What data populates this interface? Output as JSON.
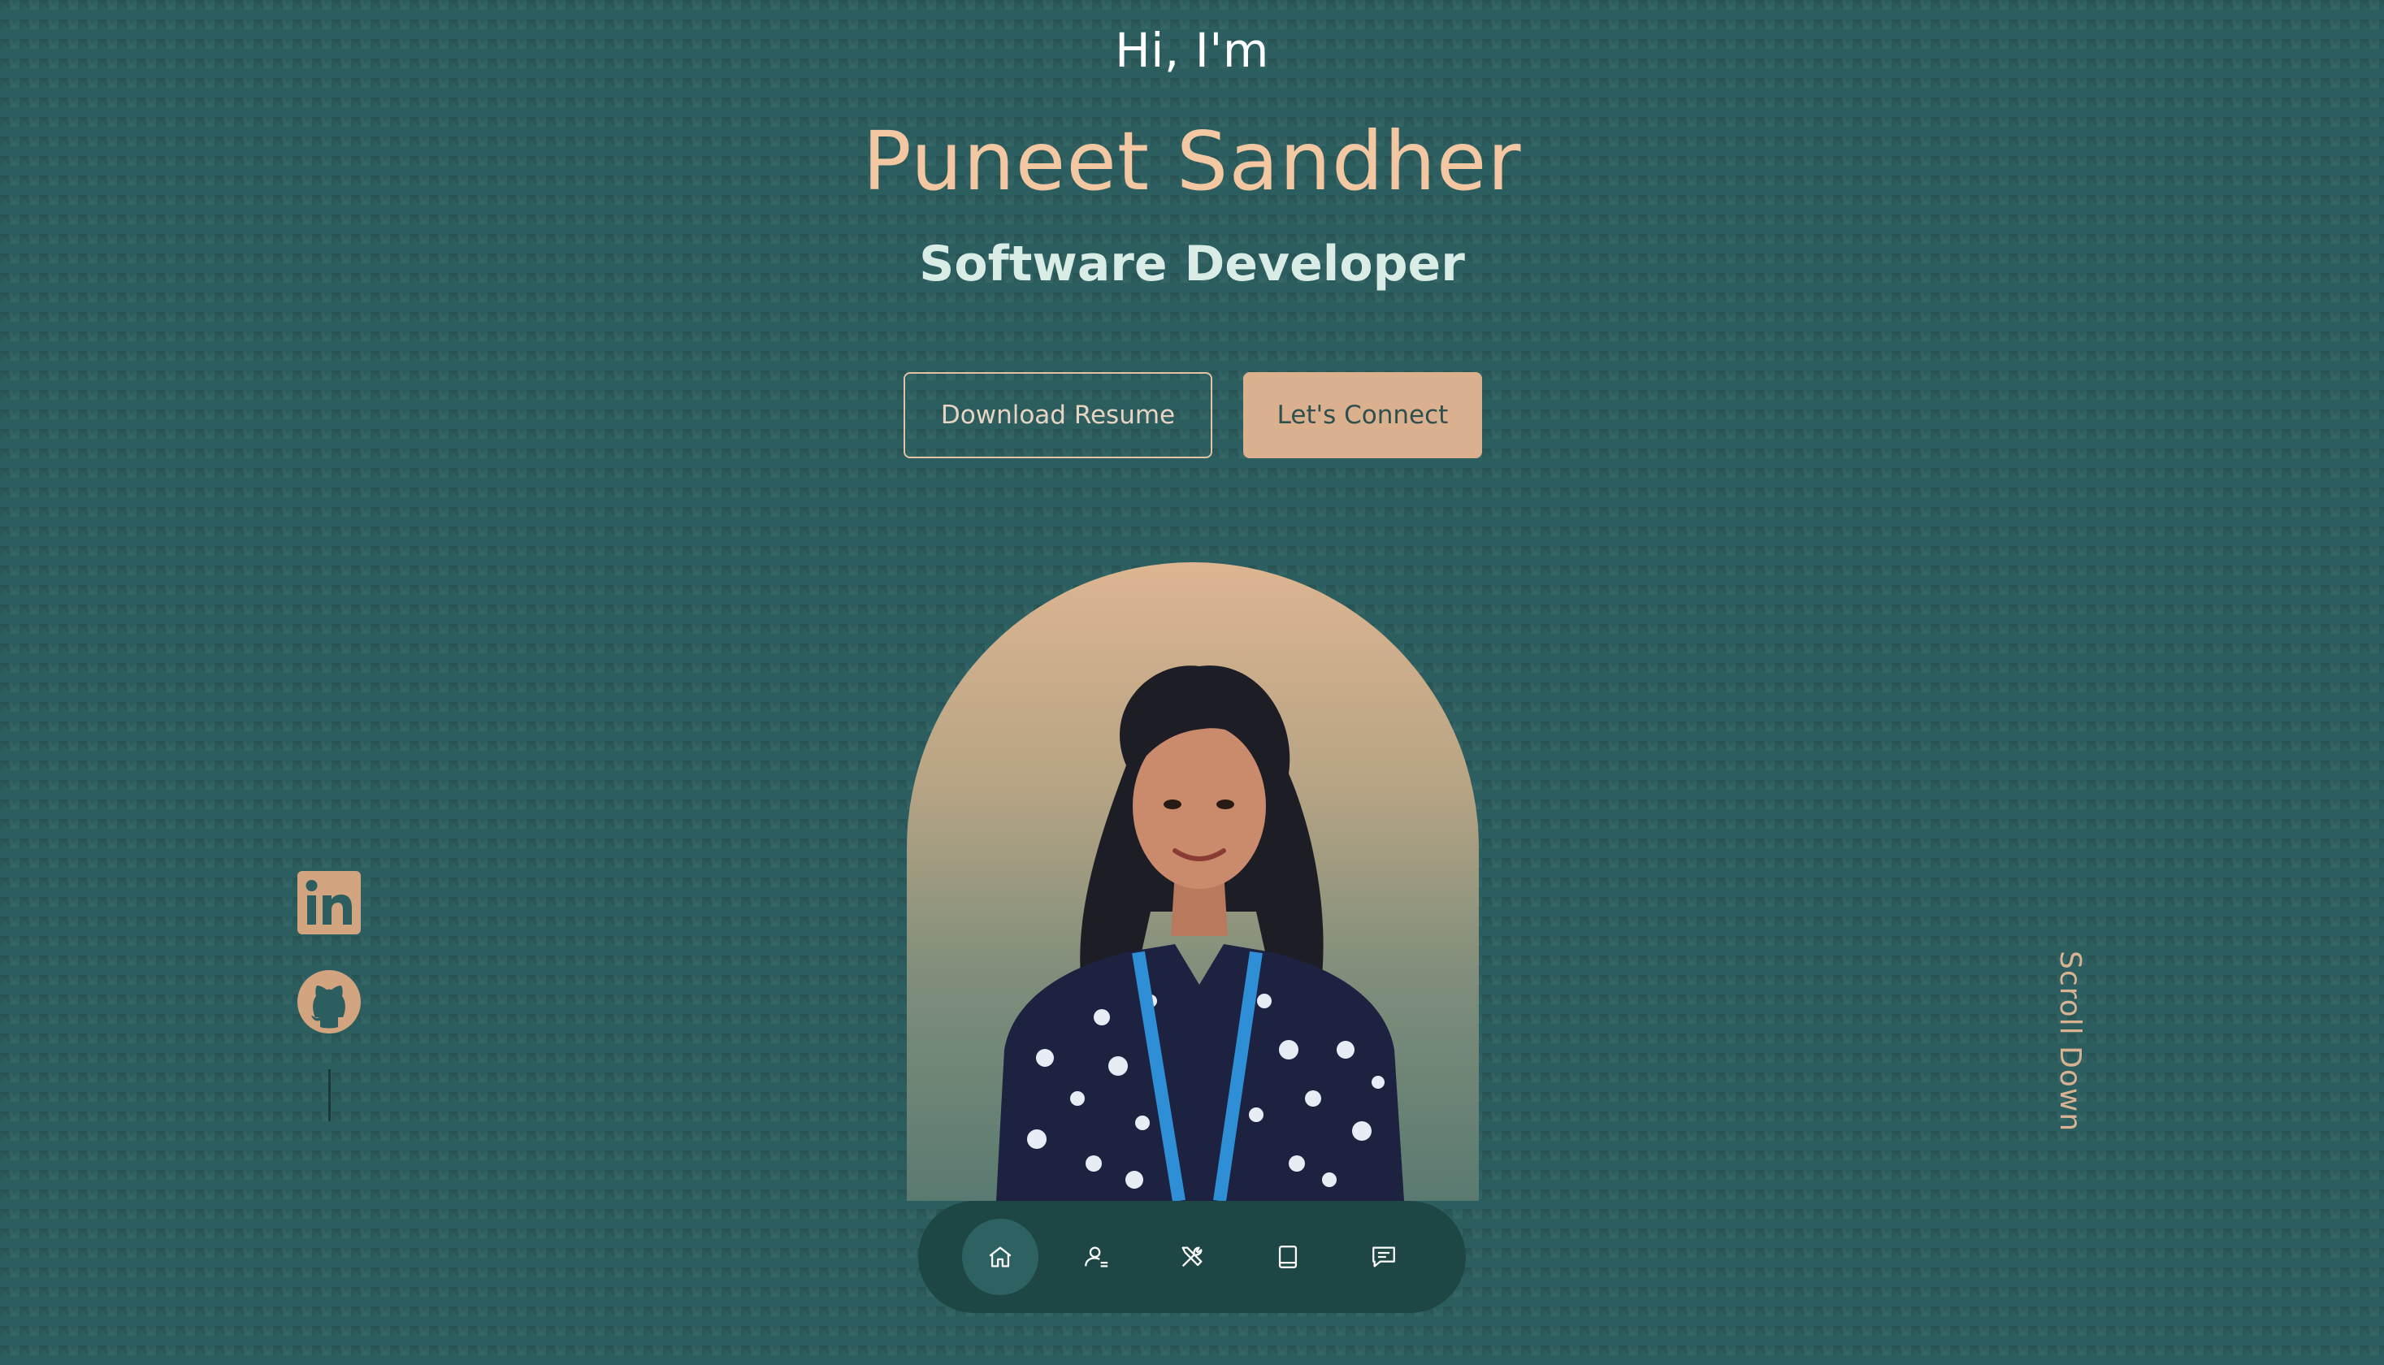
{
  "hero": {
    "greeting": "Hi, I'm",
    "name": "Puneet Sandher",
    "role": "Software Developer"
  },
  "buttons": {
    "download_resume": "Download Resume",
    "lets_connect": "Let's Connect"
  },
  "social": [
    {
      "icon": "linkedin-icon"
    },
    {
      "icon": "github-icon"
    }
  ],
  "scroll_hint": "Scroll Down",
  "nav": {
    "items": [
      {
        "icon": "home-icon",
        "active": true
      },
      {
        "icon": "user-icon",
        "active": false
      },
      {
        "icon": "tools-icon",
        "active": false
      },
      {
        "icon": "book-icon",
        "active": false
      },
      {
        "icon": "message-icon",
        "active": false
      }
    ]
  },
  "colors": {
    "background": "#2d5e5f",
    "accent": "#f2c7a1",
    "button_fill": "#dbb08e",
    "nav_background": "#1e4644"
  }
}
